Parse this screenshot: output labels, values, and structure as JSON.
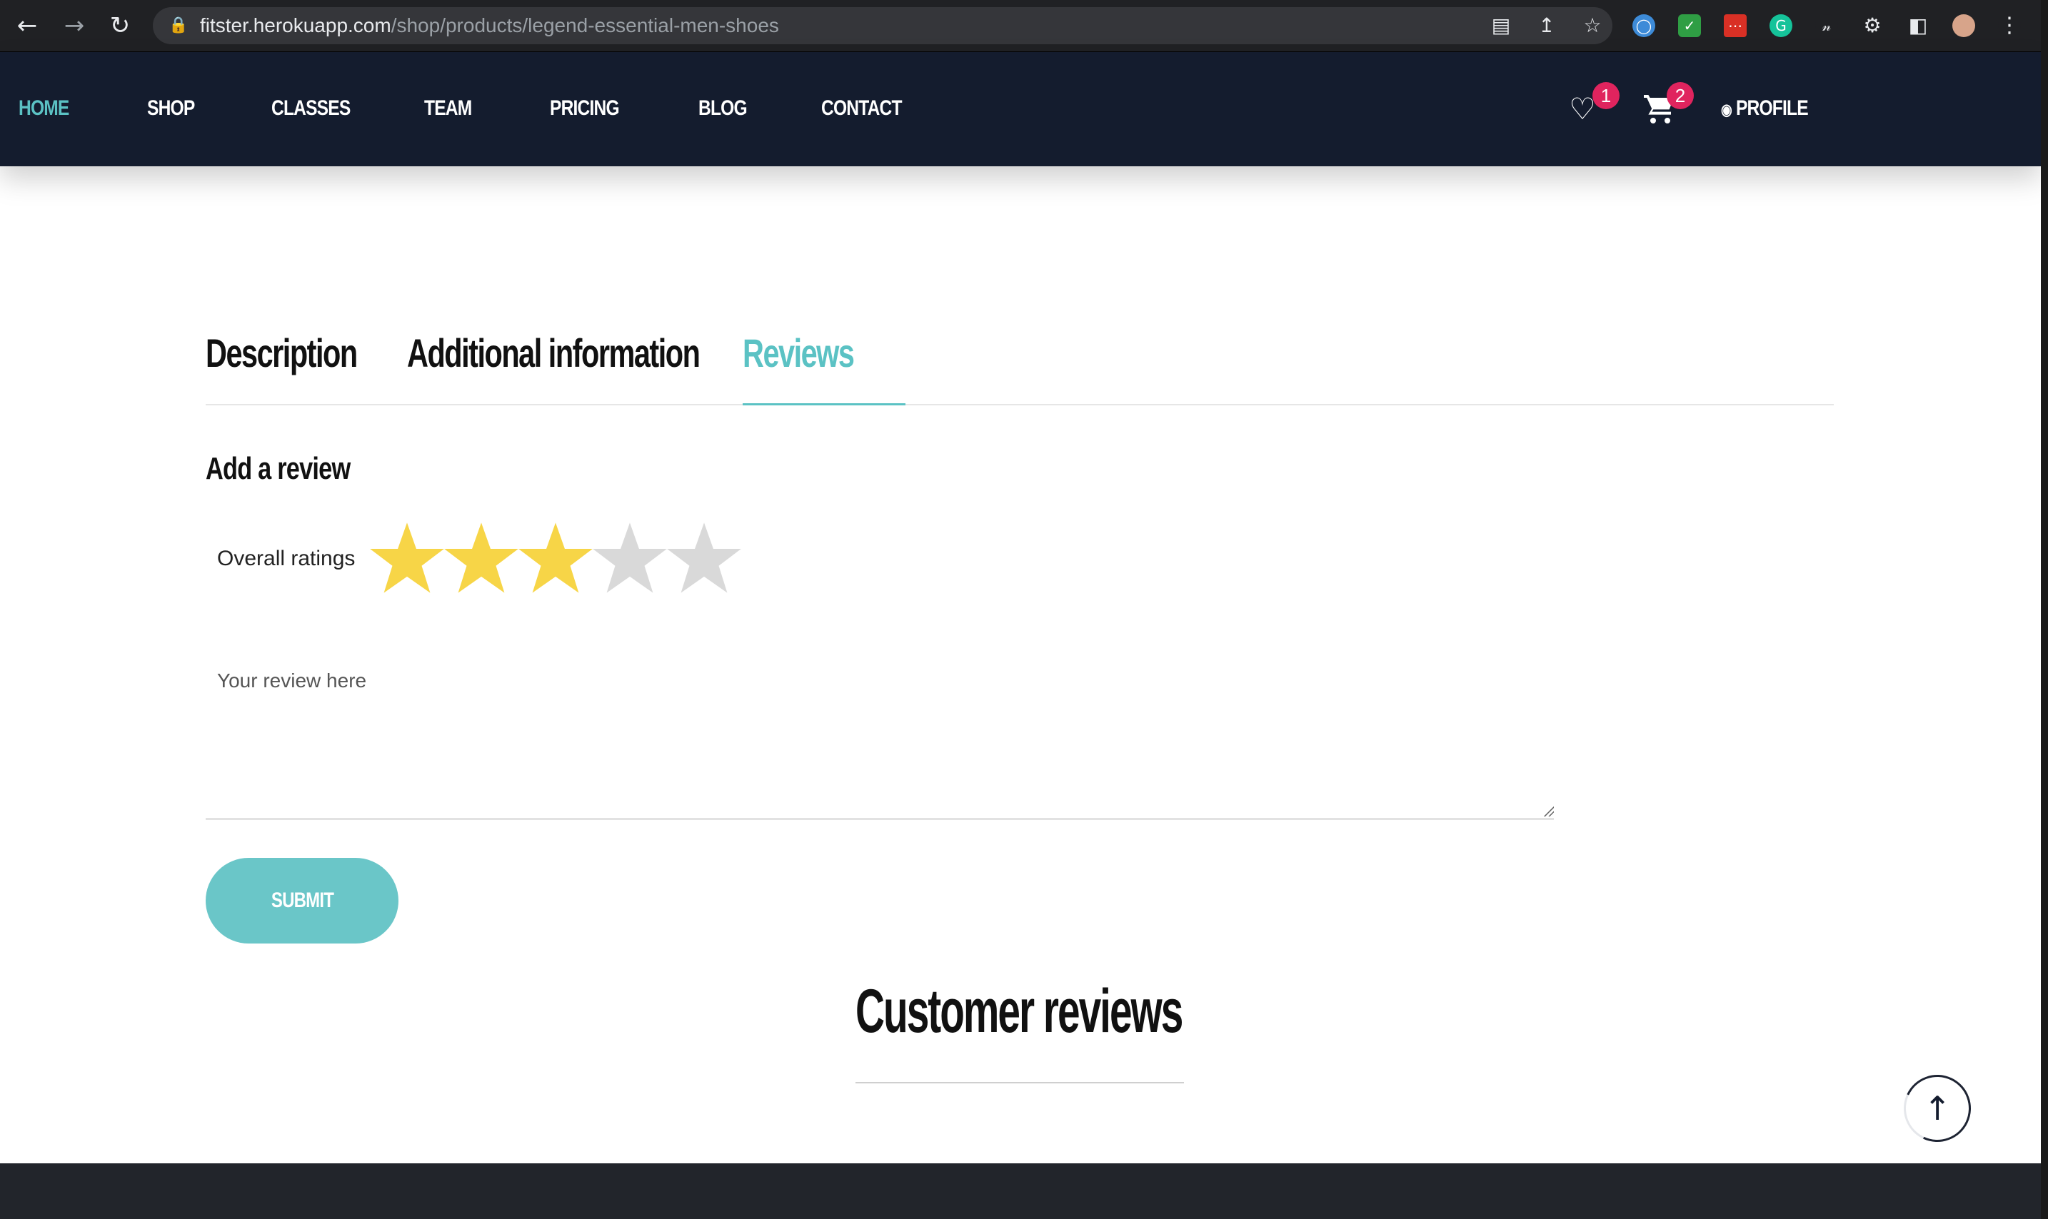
{
  "browser": {
    "url_host": "fitster.herokuapp.com",
    "url_path": "/shop/products/legend-essential-men-shoes",
    "back_icon": "arrow-left-icon",
    "forward_icon": "arrow-right-icon",
    "reload_icon": "reload-icon"
  },
  "nav": {
    "items": [
      {
        "label": "HOME",
        "active": true
      },
      {
        "label": "SHOP"
      },
      {
        "label": "CLASSES"
      },
      {
        "label": "TEAM"
      },
      {
        "label": "PRICING"
      },
      {
        "label": "BLOG"
      },
      {
        "label": "CONTACT"
      }
    ],
    "wishlist_count": "1",
    "cart_count": "2",
    "profile_label": "PROFILE"
  },
  "tabs": [
    {
      "label": "Description"
    },
    {
      "label": "Additional information"
    },
    {
      "label": "Reviews",
      "active": true
    }
  ],
  "review_form": {
    "title": "Add a review",
    "ratings_label": "Overall ratings",
    "rating": 3,
    "max_rating": 5,
    "placeholder": "Your review here",
    "submit_label": "SUBMIT"
  },
  "customer_reviews": {
    "title": "Customer reviews"
  },
  "colors": {
    "accent": "#5bc2c4",
    "header_bg": "#141c2e",
    "star_filled": "#f7d547",
    "star_empty": "#d9d9d9",
    "badge": "#e0245e"
  }
}
